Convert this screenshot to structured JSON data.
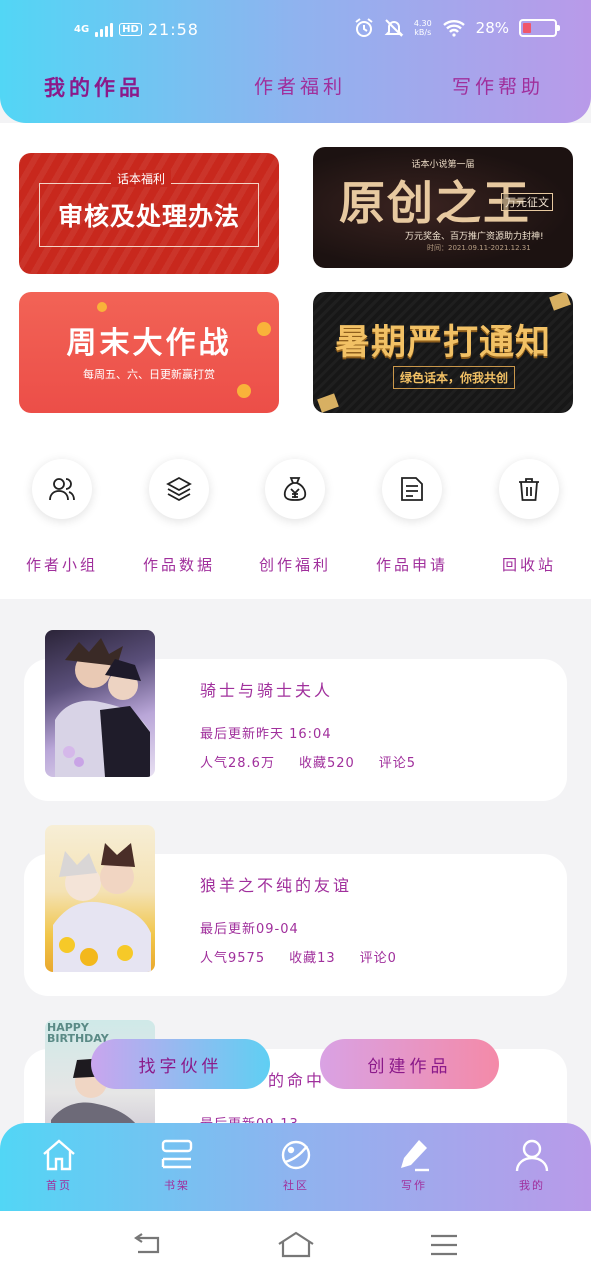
{
  "status_bar": {
    "network": "4G",
    "hd": "HD",
    "time": "21:58",
    "speed_value": "4.30",
    "speed_unit": "kB/s",
    "battery": "28%"
  },
  "header": {
    "tabs": [
      {
        "label": "我的作品",
        "active": true
      },
      {
        "label": "作者福利",
        "active": false
      },
      {
        "label": "写作帮助",
        "active": false
      }
    ]
  },
  "banners": {
    "review": {
      "tag": "话本福利",
      "title": "审核及处理办法"
    },
    "original_king": {
      "top": "话本小说第一届",
      "title": "原创之王",
      "badge": "万元征文",
      "subtitle": "万元奖金、百万推广资源助力封神!",
      "date": "时间：2021.09.11-2021.12.31"
    },
    "weekend": {
      "title": "周末大作战",
      "subtitle": "每周五、六、日更新赢打赏"
    },
    "summer": {
      "title": "暑期严打通知",
      "subtitle": "绿色话本，你我共创"
    }
  },
  "quick_actions": [
    {
      "label": "作者小组",
      "icon": "people-icon"
    },
    {
      "label": "作品数据",
      "icon": "layers-icon"
    },
    {
      "label": "创作福利",
      "icon": "money-bag-icon"
    },
    {
      "label": "作品申请",
      "icon": "document-icon"
    },
    {
      "label": "回收站",
      "icon": "trash-icon"
    }
  ],
  "works": [
    {
      "title": "骑士与骑士夫人",
      "updated": "最后更新昨天 16:04",
      "popularity": "人气28.6万",
      "favorites": "收藏520",
      "comments": "评论5"
    },
    {
      "title": "狼羊之不纯的友谊",
      "updated": "最后更新09-04",
      "popularity": "人气9575",
      "favorites": "收藏13",
      "comments": "评论0"
    },
    {
      "title": "的命中",
      "updated": "最后更新09-13",
      "cover_text": "HAPPY BIRTHDAY"
    }
  ],
  "floating": {
    "partner": "找字伙伴",
    "create": "创建作品"
  },
  "tabbar": [
    {
      "label": "首页",
      "icon": "home-icon"
    },
    {
      "label": "书架",
      "icon": "bookshelf-icon"
    },
    {
      "label": "社区",
      "icon": "planet-icon"
    },
    {
      "label": "写作",
      "icon": "pen-icon"
    },
    {
      "label": "我的",
      "icon": "user-icon"
    }
  ],
  "colors": {
    "accent": "#a02f9c",
    "gradient_start": "#52d6f5",
    "gradient_end": "#b99ae9"
  }
}
